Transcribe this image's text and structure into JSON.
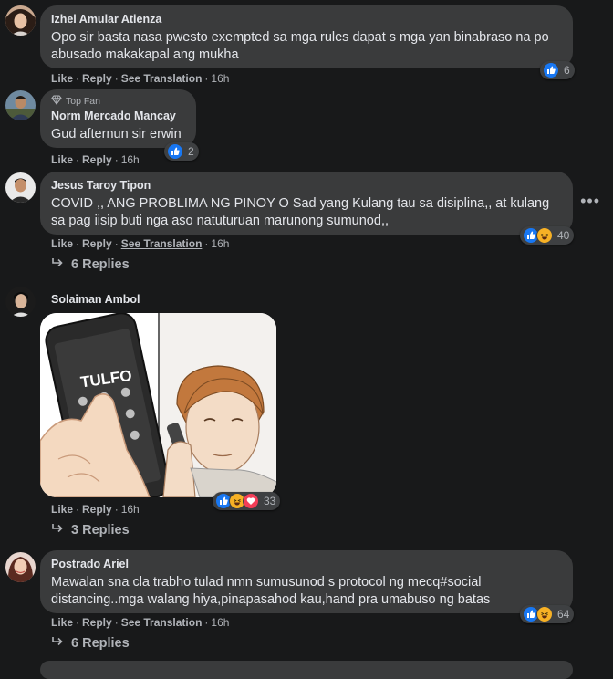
{
  "comments": [
    {
      "author": "Izhel Amular Atienza",
      "text": "Opo sir basta nasa pwesto exempted sa mga rules dapat s mga yan binabraso na po abusado makakapal ang mukha",
      "like": "Like",
      "reply": "Reply",
      "see_translation": "See Translation",
      "time": "16h",
      "reactions": [
        "like"
      ],
      "reaction_count": "6"
    },
    {
      "badge": "Top Fan",
      "author": "Norm Mercado Mancay",
      "text": "Gud afternun sir erwin",
      "like": "Like",
      "reply": "Reply",
      "time": "16h",
      "reactions": [
        "like"
      ],
      "reaction_count": "2"
    },
    {
      "author": "Jesus Taroy Tipon",
      "text": "COVID ,, ANG PROBLIMA NG PINOY O Sad yang Kulang tau sa disiplina,, at kulang sa pag iisip buti nga aso natuturuan marunong sumunod,,",
      "like": "Like",
      "reply": "Reply",
      "see_translation": "See Translation",
      "time": "16h",
      "reactions": [
        "like",
        "haha"
      ],
      "reaction_count": "40",
      "replies": "6 Replies"
    },
    {
      "author": "Solaiman Ambol",
      "image_text": "TULFO",
      "like": "Like",
      "reply": "Reply",
      "time": "16h",
      "reactions": [
        "like",
        "haha",
        "love"
      ],
      "reaction_count": "33",
      "replies": "3 Replies"
    },
    {
      "author": "Postrado Ariel",
      "text": "Mawalan sna cla trabho tulad nmn sumusunod s protocol ng mecq#social distancing..mga walang hiya,pinapasahod kau,hand pra umabuso ng batas",
      "like": "Like",
      "reply": "Reply",
      "see_translation": "See Translation",
      "time": "16h",
      "reactions": [
        "like",
        "haha"
      ],
      "reaction_count": "64",
      "replies": "6 Replies"
    }
  ],
  "colors": {
    "background": "#18191a",
    "bubble": "#3a3b3c",
    "text": "#e4e6eb",
    "secondary": "#b0b3b8",
    "like": "#1877f2",
    "haha": "#f7b125",
    "love": "#f33e58"
  },
  "icons": {
    "like": "thumbs-up-icon",
    "haha": "haha-face-icon",
    "love": "heart-icon",
    "reply_arrow": "reply-arrow-icon",
    "more": "more-options-icon",
    "top_fan": "top-fan-badge-icon"
  }
}
